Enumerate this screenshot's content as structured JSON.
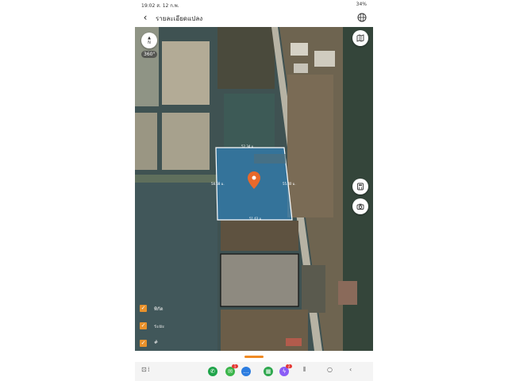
{
  "status_bar": {
    "time": "19:02",
    "date": "ส. 12 ก.พ.",
    "battery": "34%"
  },
  "app_bar": {
    "title": "รายละเอียดแปลง"
  },
  "map": {
    "compass_letters": "N",
    "pano_label": "360°",
    "plot_label_top": "52.34 ม.",
    "plot_label_left": "58.68 ม.",
    "plot_label_right": "55.40 ม.",
    "plot_label_bottom": "51.63 ม."
  },
  "layers": [
    {
      "label": "พิกัด",
      "checked": true
    },
    {
      "label": "ระยะ",
      "checked": true
    },
    {
      "label": "#",
      "checked": true
    }
  ],
  "colors": {
    "accent": "#f08a24",
    "plot_fill": "#2e86c1",
    "plot_border": "#ffffff",
    "pin": "#e8692b"
  },
  "nav": {
    "badge_msg": "1",
    "badge_chat": "2"
  }
}
